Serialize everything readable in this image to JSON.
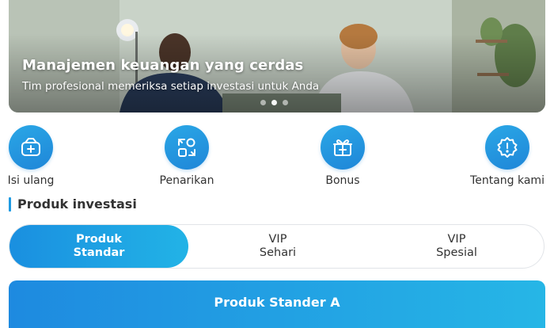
{
  "banner": {
    "title": "Manajemen keuangan yang cerdas",
    "subtitle": "Tim profesional memeriksa setiap investasi untuk Anda",
    "slide_count": 3,
    "active_slide": 1
  },
  "quick_actions": [
    {
      "label": "Isi ulang",
      "icon": "wallet-plus-icon"
    },
    {
      "label": "Penarikan",
      "icon": "withdraw-swap-icon"
    },
    {
      "label": "Bonus",
      "icon": "gift-box-icon"
    },
    {
      "label": "Tentang kami",
      "icon": "info-badge-icon"
    }
  ],
  "section": {
    "title": "Produk investasi"
  },
  "tabs": [
    {
      "line1": "Produk",
      "line2": "Standar",
      "active": true
    },
    {
      "line1": "VIP",
      "line2": "Sehari",
      "active": false
    },
    {
      "line1": "VIP",
      "line2": "Spesial",
      "active": false
    }
  ],
  "product": {
    "title": "Produk Stander A"
  },
  "colors": {
    "accent": "#1f9be2",
    "gradient_start": "#1a8fe0",
    "gradient_end": "#22b3e6"
  }
}
